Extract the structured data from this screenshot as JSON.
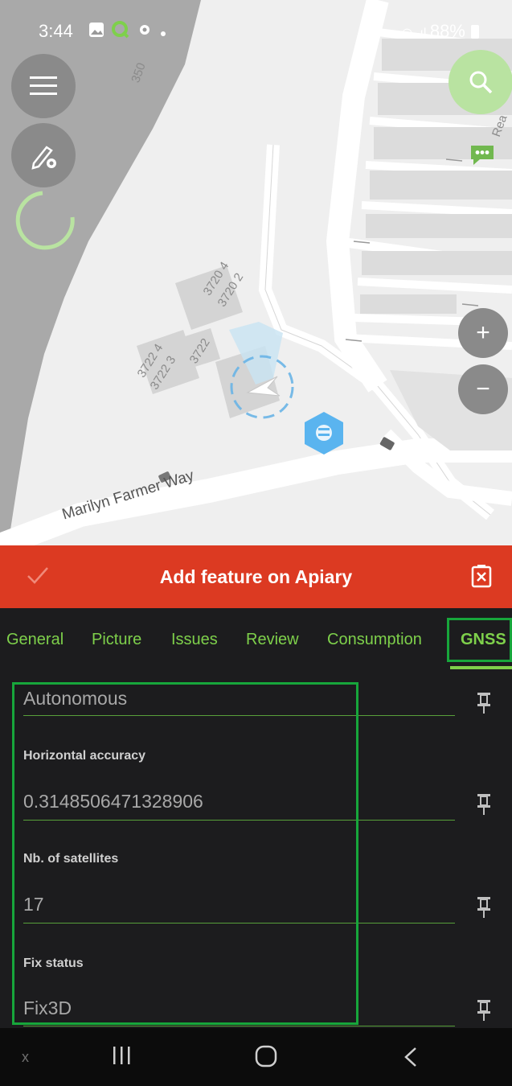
{
  "status_bar": {
    "time": "3:44",
    "battery": "88%"
  },
  "map": {
    "labels": {
      "contour_350": "350",
      "bldg_3720_4": "3720 4",
      "bldg_3720_2": "3720 2",
      "bldg_3722_4": "3722 4",
      "bldg_3722_3": "3722 3",
      "bldg_3722": "3722",
      "road": "Marilyn Farmer Way",
      "edge_text": "Rea"
    },
    "zoom_in": "+",
    "zoom_out": "−"
  },
  "form": {
    "title": "Add feature on Apiary",
    "tabs": [
      "General",
      "Picture",
      "Issues",
      "Review",
      "Consumption",
      "GNSS"
    ],
    "active_tab": "GNSS",
    "fields": {
      "fix_mode_value": "Autonomous",
      "horizontal_accuracy_label": "Horizontal accuracy",
      "horizontal_accuracy_value": "0.3148506471328906",
      "satellites_label": "Nb. of satellites",
      "satellites_value": "17",
      "fix_status_label": "Fix status",
      "fix_status_value": "Fix3D"
    }
  },
  "nav_bar": {
    "x_label": "x"
  },
  "colors": {
    "header_red": "#dc3a22",
    "accent_green": "#7ed04b",
    "highlight_green": "#17a63b",
    "dark_bg": "#1c1c1e"
  }
}
